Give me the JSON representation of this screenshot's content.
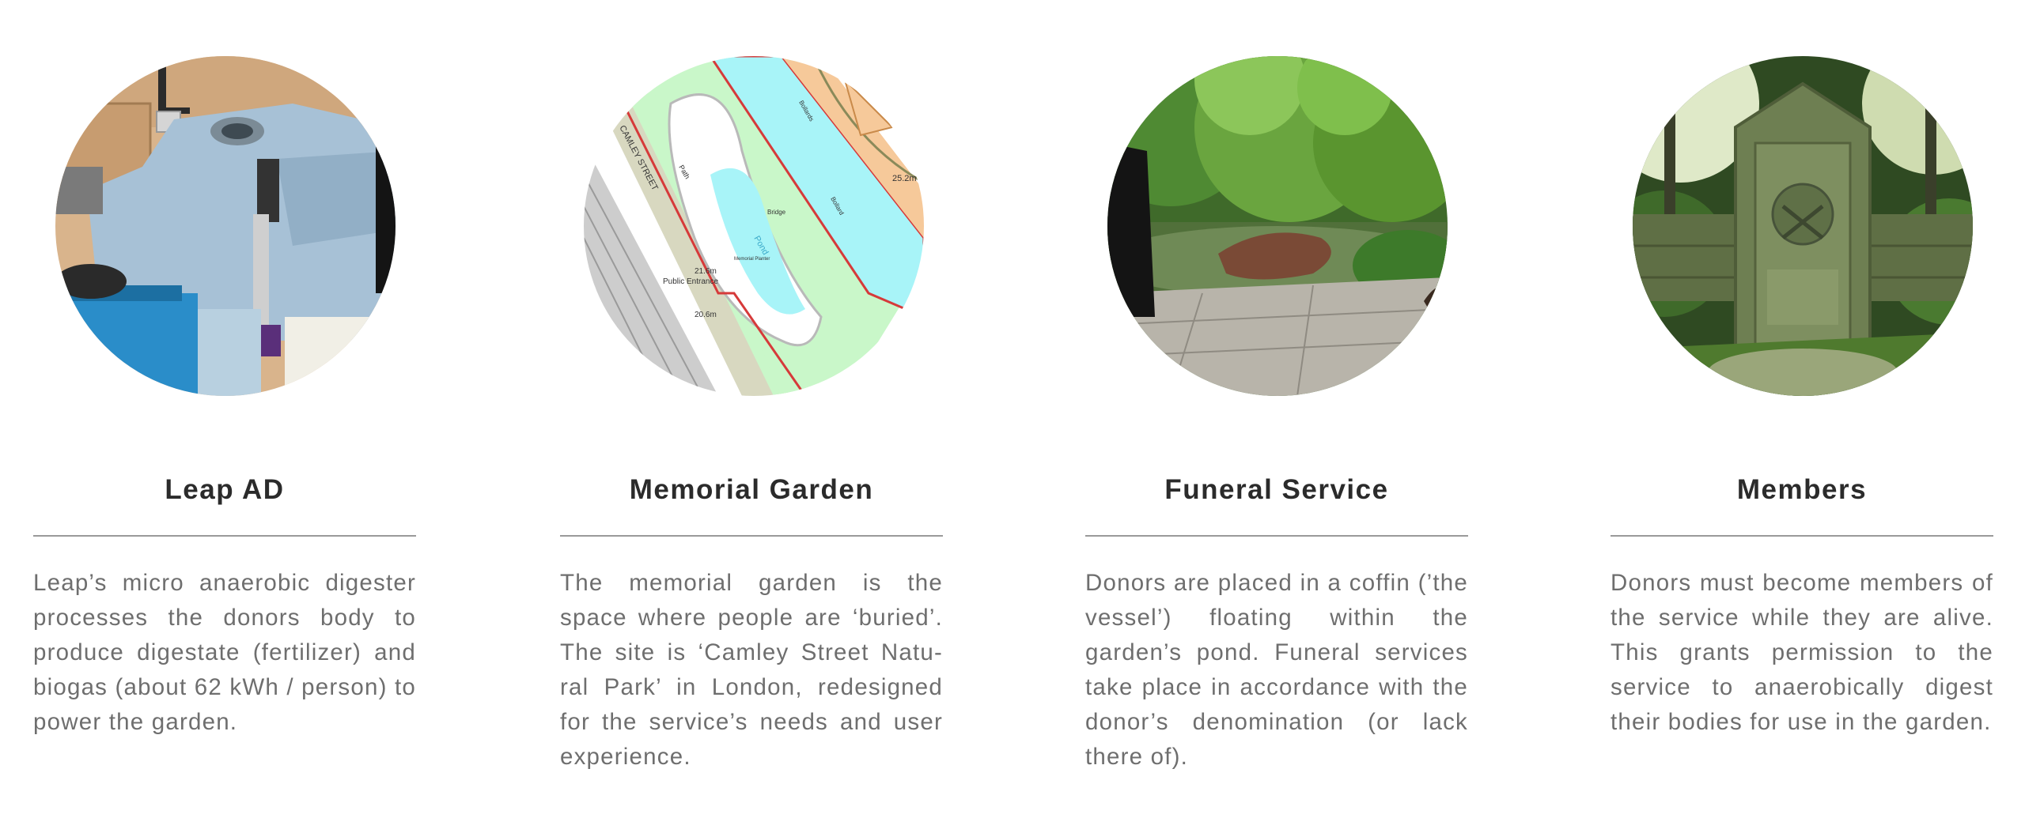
{
  "cards": [
    {
      "image_icon": "anaerobic-digester-photo",
      "title": "Leap AD",
      "description": "Leap’s micro anaerobic digester processes the donors body to produce digestate (fertilizer) and biogas (about 62 kWh / person) to power the garden."
    },
    {
      "image_icon": "site-map-image",
      "title": "Memorial Garden",
      "description": "The memorial garden is the space where people are ‘buried’. The site is ‘Camley Street Natu-ral Park’ in London, redesigned for the service’s needs and user experience.",
      "map_labels": {
        "street": "CAMLEY STREET",
        "path": "Path",
        "bridge": "Bridge",
        "pond": "Pond",
        "memorial": "Memorial Planter",
        "entrance": "Public Entrance",
        "height_1": "21.6m",
        "height_2": "20.6m",
        "height_3": "25.2m",
        "bollards": "Bollards",
        "bollard": "Bollard"
      }
    },
    {
      "image_icon": "garden-pond-photo",
      "title": "Funeral Service",
      "description": "Donors are placed in a coffin (’the vessel’) floating within the garden’s pond. Funeral services take place in accordance with the donor’s denomination (or lack there of)."
    },
    {
      "image_icon": "gravestone-photo",
      "title": "Members",
      "description": "Donors must become members of the service while they are alive. This grants permission to the service to anaerobically digest their bodies for use in the garden."
    }
  ],
  "colors": {
    "title": "#2b2b2b",
    "text": "#6e6e6e",
    "rule": "#9a9a9a",
    "map_water": "#a8f4f8",
    "map_green": "#c9f7c9"
  }
}
